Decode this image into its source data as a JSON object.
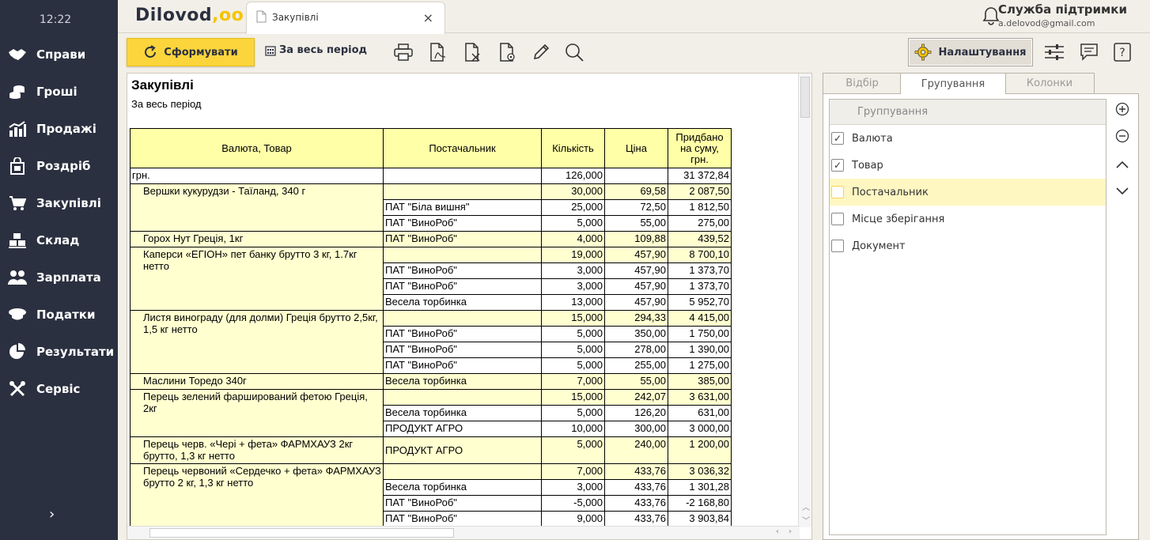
{
  "sidebar": {
    "time": "12:22",
    "items": [
      {
        "label": "Справи",
        "icon": "handshake-icon"
      },
      {
        "label": "Гроші",
        "icon": "coins-icon"
      },
      {
        "label": "Продажі",
        "icon": "chart-icon"
      },
      {
        "label": "Роздріб",
        "icon": "shopping-bag-icon"
      },
      {
        "label": "Закупівлі",
        "icon": "cart-icon"
      },
      {
        "label": "Склад",
        "icon": "boxes-icon"
      },
      {
        "label": "Зарплата",
        "icon": "people-icon"
      },
      {
        "label": "Податки",
        "icon": "officer-cap-icon"
      },
      {
        "label": "Результати",
        "icon": "pie-chart-icon"
      },
      {
        "label": "Сервіс",
        "icon": "tools-icon"
      }
    ],
    "expand": "›"
  },
  "header": {
    "logo_text": "Dilovod",
    "logo_mark": ",oo",
    "tab_title": "Закупівлі",
    "tab_close": "×",
    "support_name": "Служба підтримки",
    "support_email": "a.delovod@gmail.com"
  },
  "toolbar": {
    "form_label": "Сформувати",
    "period_label": "За весь період",
    "settings_label": "Налаштування"
  },
  "report": {
    "title": "Закупівлі",
    "subtitle": "За весь період",
    "columns": [
      "Валюта, Товар",
      "Постачальник",
      "Кількість",
      "Ціна",
      "Придбано на суму, грн."
    ],
    "rows": [
      {
        "kind": "currency",
        "name": "грн.",
        "span": 1,
        "supplier": "",
        "qty": "126,000",
        "price": "",
        "sum": "31 372,84"
      },
      {
        "kind": "product",
        "name": "Вершки кукурудзи - Таїланд, 340 г",
        "span": 3,
        "supplier": "",
        "qty": "30,000",
        "price": "69,58",
        "sum": "2 087,50"
      },
      {
        "kind": "supplier",
        "supplier": "ПАТ \"Біла вишня\"",
        "qty": "25,000",
        "price": "72,50",
        "sum": "1 812,50"
      },
      {
        "kind": "supplier",
        "supplier": "ПАТ \"ВиноРоб\"",
        "qty": "5,000",
        "price": "55,00",
        "sum": "275,00"
      },
      {
        "kind": "product",
        "name": "Горох Нут Греція, 1кг",
        "span": 1,
        "supplier": "ПАТ \"ВиноРоб\"",
        "qty": "4,000",
        "price": "109,88",
        "sum": "439,52"
      },
      {
        "kind": "product",
        "name": "Каперси «ЕГІОН» пет банку брутто 3 кг, 1.7кг нетто",
        "span": 4,
        "supplier": "",
        "qty": "19,000",
        "price": "457,90",
        "sum": "8 700,10"
      },
      {
        "kind": "supplier",
        "supplier": "ПАТ \"ВиноРоб\"",
        "qty": "3,000",
        "price": "457,90",
        "sum": "1 373,70"
      },
      {
        "kind": "supplier",
        "supplier": "ПАТ \"ВиноРоб\"",
        "qty": "3,000",
        "price": "457,90",
        "sum": "1 373,70"
      },
      {
        "kind": "supplier",
        "supplier": "Весела торбинка",
        "qty": "13,000",
        "price": "457,90",
        "sum": "5 952,70"
      },
      {
        "kind": "product",
        "name": "Листя винограду (для долми) Греція брутто 2,5кг, 1,5 кг нетто",
        "span": 4,
        "supplier": "",
        "qty": "15,000",
        "price": "294,33",
        "sum": "4 415,00"
      },
      {
        "kind": "supplier",
        "supplier": "ПАТ \"ВиноРоб\"",
        "qty": "5,000",
        "price": "350,00",
        "sum": "1 750,00"
      },
      {
        "kind": "supplier",
        "supplier": "ПАТ \"ВиноРоб\"",
        "qty": "5,000",
        "price": "278,00",
        "sum": "1 390,00"
      },
      {
        "kind": "supplier",
        "supplier": "ПАТ \"ВиноРоб\"",
        "qty": "5,000",
        "price": "255,00",
        "sum": "1 275,00"
      },
      {
        "kind": "product",
        "name": "Маслини Торедо 340г",
        "span": 1,
        "supplier": "Весела торбинка",
        "qty": "7,000",
        "price": "55,00",
        "sum": "385,00"
      },
      {
        "kind": "product",
        "name": "Перець зелений фарширований фетою Греція, 2кг",
        "span": 3,
        "supplier": "",
        "qty": "15,000",
        "price": "242,07",
        "sum": "3 631,00"
      },
      {
        "kind": "supplier",
        "supplier": "Весела торбинка",
        "qty": "5,000",
        "price": "126,20",
        "sum": "631,00"
      },
      {
        "kind": "supplier",
        "supplier": "ПРОДУКТ АГРО",
        "qty": "10,000",
        "price": "300,00",
        "sum": "3 000,00"
      },
      {
        "kind": "product",
        "name": "Перець черв. «Чері + фета» ФАРМХАУЗ 2кг брутто, 1,3 кг нетто",
        "span": 1,
        "tall": true,
        "supplier": "ПРОДУКТ АГРО",
        "qty": "5,000",
        "price": "240,00",
        "sum": "1 200,00"
      },
      {
        "kind": "product",
        "name": "Перець червоний «Сердечко + фета» ФАРМХАУЗ брутто 2 кг, 1,3 кг нетто",
        "span": 4,
        "supplier": "",
        "qty": "7,000",
        "price": "433,76",
        "sum": "3 036,32"
      },
      {
        "kind": "supplier",
        "supplier": "Весела торбинка",
        "qty": "3,000",
        "price": "433,76",
        "sum": "1 301,28"
      },
      {
        "kind": "supplier",
        "supplier": "ПАТ \"ВиноРоб\"",
        "qty": "-5,000",
        "price": "433,76",
        "sum": "-2 168,80"
      },
      {
        "kind": "supplier",
        "supplier": "ПАТ \"ВиноРоб\"",
        "qty": "9,000",
        "price": "433,76",
        "sum": "3 903,84"
      }
    ]
  },
  "panel": {
    "tabs": [
      "Відбір",
      "Групування",
      "Колонки"
    ],
    "active_tab": 1,
    "list_header": "Группування",
    "items": [
      {
        "label": "Валюта",
        "checked": true
      },
      {
        "label": "Товар",
        "checked": true
      },
      {
        "label": "Постачальник",
        "checked": false,
        "selected": true
      },
      {
        "label": "Місце зберігання",
        "checked": false
      },
      {
        "label": "Документ",
        "checked": false
      }
    ]
  },
  "colors": {
    "sidebar_bg": "#2b3040",
    "accent_yellow": "#fbd53b",
    "table_header": "#ffffa8",
    "table_group": "#ffffd0"
  }
}
